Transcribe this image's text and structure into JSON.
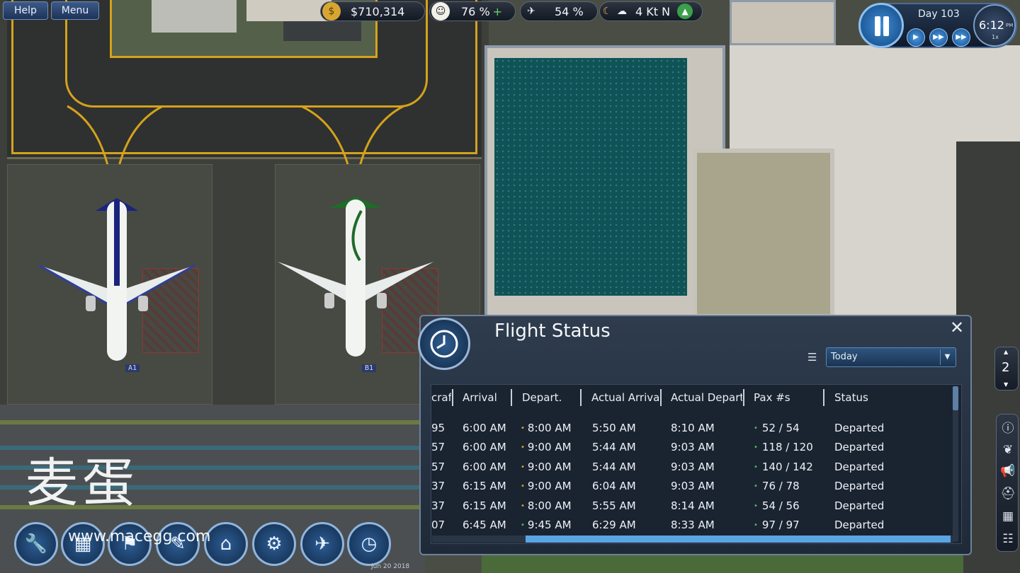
{
  "hud": {
    "help_label": "Help",
    "menu_label": "Menu",
    "money": "$710,314",
    "happiness": "76 %",
    "happiness_trend": "+",
    "flights": "54 %",
    "wind": "4 Kt N",
    "day": "Day 103",
    "time": "6:12",
    "time_suffix": "PM",
    "time_speed": "1x"
  },
  "stands": {
    "a1": "A1",
    "b1": "B1"
  },
  "flight_status": {
    "title": "Flight Status",
    "filter": "Today",
    "columns": [
      "craft",
      "Arrival",
      "Depart.",
      "Actual Arrival",
      "Actual Depart.",
      "Pax #s",
      "Status"
    ],
    "rows": [
      {
        "craft": "95",
        "arrival": "6:00 AM",
        "depart": "8:00 AM",
        "actual_arrival": "5:50 AM",
        "actual_depart": "8:10 AM",
        "pax": "52 / 54",
        "status": "Departed",
        "depart_dot": "orange"
      },
      {
        "craft": "57",
        "arrival": "6:00 AM",
        "depart": "9:00 AM",
        "actual_arrival": "5:44 AM",
        "actual_depart": "9:03 AM",
        "pax": "118 / 120",
        "status": "Departed",
        "depart_dot": "orange"
      },
      {
        "craft": "57",
        "arrival": "6:00 AM",
        "depart": "9:00 AM",
        "actual_arrival": "5:44 AM",
        "actual_depart": "9:03 AM",
        "pax": "140 / 142",
        "status": "Departed",
        "depart_dot": "orange"
      },
      {
        "craft": "37",
        "arrival": "6:15 AM",
        "depart": "9:00 AM",
        "actual_arrival": "6:04 AM",
        "actual_depart": "9:03 AM",
        "pax": "76 / 78",
        "status": "Departed",
        "depart_dot": "orange"
      },
      {
        "craft": "37",
        "arrival": "6:15 AM",
        "depart": "8:00 AM",
        "actual_arrival": "5:55 AM",
        "actual_depart": "8:14 AM",
        "pax": "54 / 56",
        "status": "Departed",
        "depart_dot": "orange"
      },
      {
        "craft": "07",
        "arrival": "6:45 AM",
        "depart": "9:45 AM",
        "actual_arrival": "6:29 AM",
        "actual_depart": "8:33 AM",
        "pax": "97 / 97",
        "status": "Departed",
        "depart_dot": "green"
      }
    ]
  },
  "floor": {
    "current": "2"
  },
  "watermark": {
    "text": "麦蛋",
    "url": "www.macegg.com"
  },
  "date_stamp": "Jun 20 2018",
  "colors": {
    "accent": "#59a6e2",
    "taxi_line": "#d4a21c",
    "lounge": "#0f5357",
    "dot_orange": "#e2a33a",
    "dot_green": "#4fc05a"
  }
}
